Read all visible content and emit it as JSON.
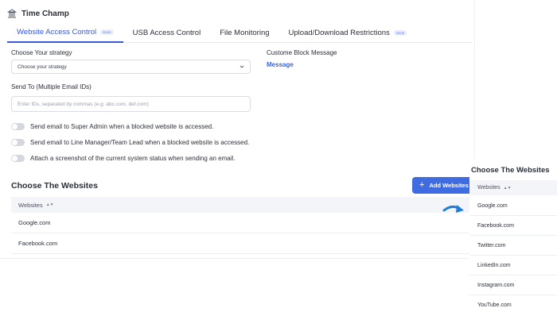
{
  "app": {
    "title": "Time Champ",
    "icon": "building-icon"
  },
  "tabs": [
    {
      "label": "Website Access Control",
      "badge": "Soon",
      "active": true
    },
    {
      "label": "USB Access Control",
      "badge": "",
      "active": false
    },
    {
      "label": "File Monitoring",
      "badge": "",
      "active": false
    },
    {
      "label": "Upload/Download Restrictions",
      "badge": "Soon",
      "active": false
    }
  ],
  "strategy": {
    "label": "Choose Your strategy",
    "value": "Choose your strategy"
  },
  "block_message": {
    "label": "Custome Block Message",
    "link": "Message"
  },
  "send_to": {
    "label": "Send To (Multiple Email IDs)",
    "placeholder": "Enter IDs, separated by commas (e.g: abc.com, def.com)"
  },
  "toggles": [
    {
      "label": "Send email to Super Admin when a blocked website is accessed.",
      "on": false
    },
    {
      "label": "Send email to Line Manager/Team Lead when a blocked website is accessed.",
      "on": false
    },
    {
      "label": "Attach a screenshot of the current system status when sending an email.",
      "on": false
    }
  ],
  "websites_section": {
    "title": "Choose The Websites",
    "add_button": "Add Websites",
    "column": "Websites",
    "rows": [
      "Google.com",
      "Facebook.com"
    ]
  },
  "popup": {
    "title": "Choose The Websites",
    "column": "Websites",
    "rows": [
      "Google.com",
      "Facebook.com",
      "Twitter.com",
      "LinkedIn.com",
      "Instagram.com",
      "YouTube.com"
    ]
  },
  "colors": {
    "accent": "#3a57d6",
    "button": "#3f6ce0",
    "arrow": "#1f7fd6"
  }
}
